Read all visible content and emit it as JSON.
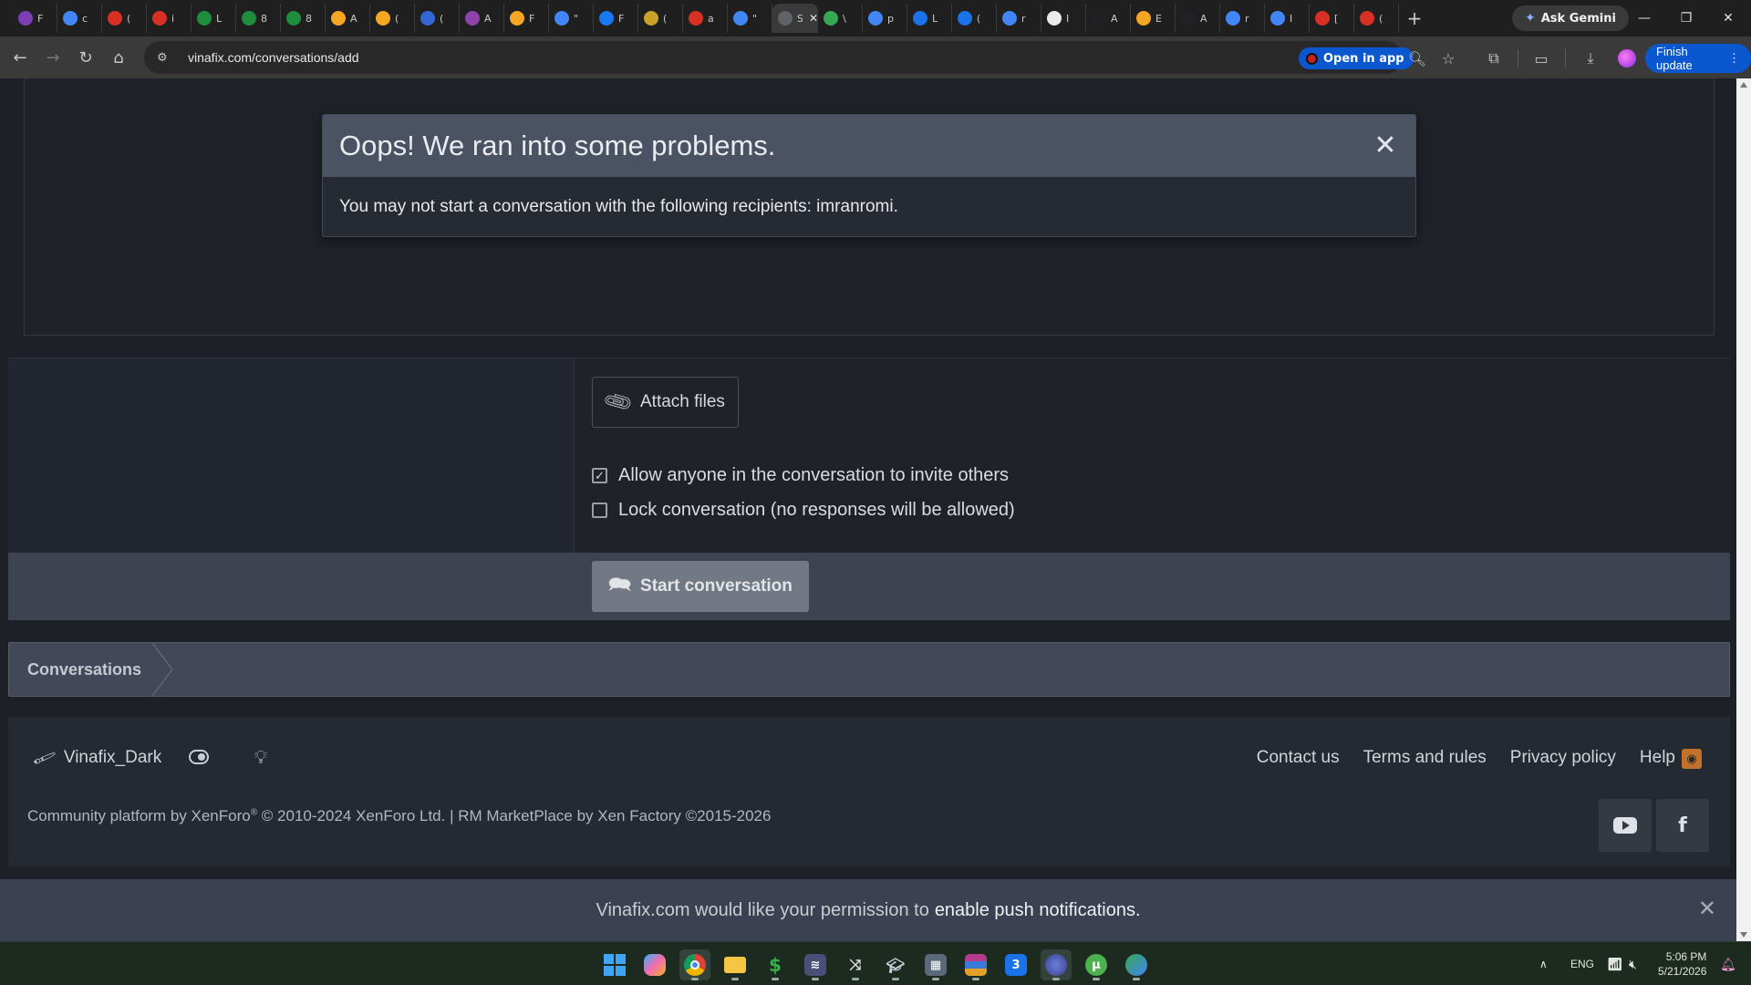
{
  "browser": {
    "tabs": [
      {
        "letter": "F",
        "color": "#7b3fb3"
      },
      {
        "letter": "c",
        "color": "#4285f4"
      },
      {
        "letter": "(",
        "color": "#d93025"
      },
      {
        "letter": "i",
        "color": "#d93025"
      },
      {
        "letter": "L",
        "color": "#1e8e3e"
      },
      {
        "letter": "8",
        "color": "#1e8e3e"
      },
      {
        "letter": "8",
        "color": "#1e8e3e"
      },
      {
        "letter": "A",
        "color": "#f5a623"
      },
      {
        "letter": "(",
        "color": "#f5a623"
      },
      {
        "letter": "(",
        "color": "#3367d6"
      },
      {
        "letter": "A",
        "color": "#8e44ad"
      },
      {
        "letter": "F",
        "color": "#f5a623"
      },
      {
        "letter": "\"",
        "color": "#4285f4"
      },
      {
        "letter": "F",
        "color": "#1877f2"
      },
      {
        "letter": "(",
        "color": "#c9a227"
      },
      {
        "letter": "a",
        "color": "#d93025"
      },
      {
        "letter": "\"",
        "color": "#4285f4"
      },
      {
        "letter": "S",
        "color": "#5f6368",
        "active": true
      },
      {
        "letter": "\\",
        "color": "#34a853"
      },
      {
        "letter": "p",
        "color": "#4285f4"
      },
      {
        "letter": "L",
        "color": "#1a73e8"
      },
      {
        "letter": "(",
        "color": "#1a73e8"
      },
      {
        "letter": "r",
        "color": "#4285f4"
      },
      {
        "letter": "I",
        "color": "#e8eaed"
      },
      {
        "letter": "A",
        "color": "#202124"
      },
      {
        "letter": "E",
        "color": "#f5a623"
      },
      {
        "letter": "A",
        "color": "#202124"
      },
      {
        "letter": "r",
        "color": "#4285f4"
      },
      {
        "letter": "I",
        "color": "#4285f4"
      },
      {
        "letter": "[",
        "color": "#d93025"
      },
      {
        "letter": "(",
        "color": "#d93025"
      }
    ],
    "new_tab_icon": "plus-icon",
    "gemini_label": "Ask Gemini",
    "url": "vinafix.com/conversations/add",
    "open_in_app_label": "Open in app",
    "finish_update_label": "Finish update"
  },
  "modal": {
    "title": "Oops! We ran into some problems.",
    "message": "You may not start a conversation with the following recipients: imranromi.",
    "close_glyph": "✕"
  },
  "form": {
    "attach_label": "Attach files",
    "options": [
      {
        "label": "Allow anyone in the conversation to invite others",
        "checked": true
      },
      {
        "label": "Lock conversation (no responses will be allowed)",
        "checked": false
      }
    ],
    "submit_label": "Start conversation"
  },
  "breadcrumb": {
    "items": [
      "Conversations"
    ]
  },
  "footer": {
    "style_name": "Vinafix_Dark",
    "links": [
      "Contact us",
      "Terms and rules",
      "Privacy policy",
      "Help"
    ],
    "copyright_prefix": "Community platform by XenForo",
    "copyright_reg": "®",
    "copyright_suffix": " © 2010-2024 XenForo Ltd. | RM MarketPlace by Xen Factory ©2015-2026"
  },
  "push": {
    "prefix": "Vinafix.com would like your permission to",
    "link": "enable push notifications."
  },
  "taskbar": {
    "language": "ENG",
    "time": "5:06 PM",
    "date": "5/21/2026"
  },
  "colors": {
    "accent_blue": "#0b57d0",
    "modal_header": "#4b5261",
    "page_bg": "#1d2026"
  }
}
